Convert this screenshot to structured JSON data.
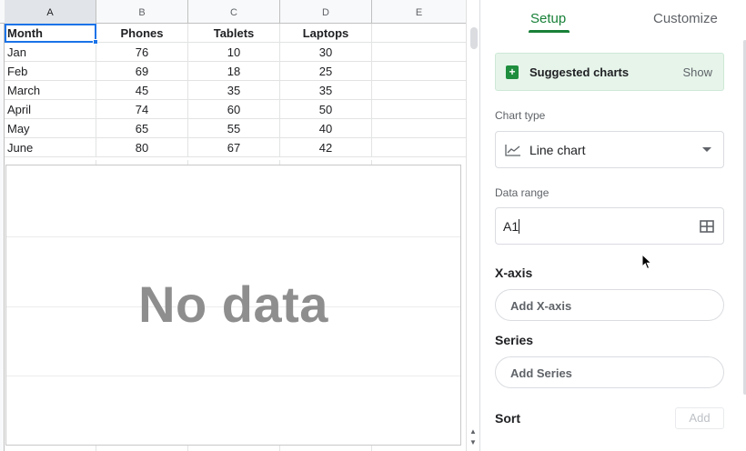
{
  "sheet": {
    "column_headers": [
      "A",
      "B",
      "C",
      "D",
      "E"
    ],
    "rows": [
      [
        "Month",
        "Phones",
        "Tablets",
        "Laptops",
        ""
      ],
      [
        "Jan",
        "76",
        "10",
        "30",
        ""
      ],
      [
        "Feb",
        "69",
        "18",
        "25",
        ""
      ],
      [
        "March",
        "45",
        "35",
        "35",
        ""
      ],
      [
        "April",
        "74",
        "60",
        "50",
        ""
      ],
      [
        "May",
        "65",
        "55",
        "40",
        ""
      ],
      [
        "June",
        "80",
        "67",
        "42",
        ""
      ]
    ],
    "selected_cell": "A1"
  },
  "chart": {
    "placeholder_text": "No data"
  },
  "editor": {
    "tabs": [
      {
        "label": "Setup",
        "active": true
      },
      {
        "label": "Customize",
        "active": false
      }
    ],
    "suggested": {
      "label": "Suggested charts",
      "action": "Show"
    },
    "chart_type": {
      "label": "Chart type",
      "value": "Line chart",
      "icon": "line-chart-icon"
    },
    "data_range": {
      "label": "Data range",
      "value": "A1",
      "icon": "grid-select-icon"
    },
    "x_axis": {
      "heading": "X-axis",
      "placeholder": "Add X-axis"
    },
    "series": {
      "heading": "Series",
      "placeholder": "Add Series"
    },
    "sort": {
      "heading": "Sort",
      "action": "Add"
    }
  },
  "colors": {
    "accent_green": "#188038",
    "selection_blue": "#1a73e8",
    "suggested_bg": "#e6f4ea"
  }
}
